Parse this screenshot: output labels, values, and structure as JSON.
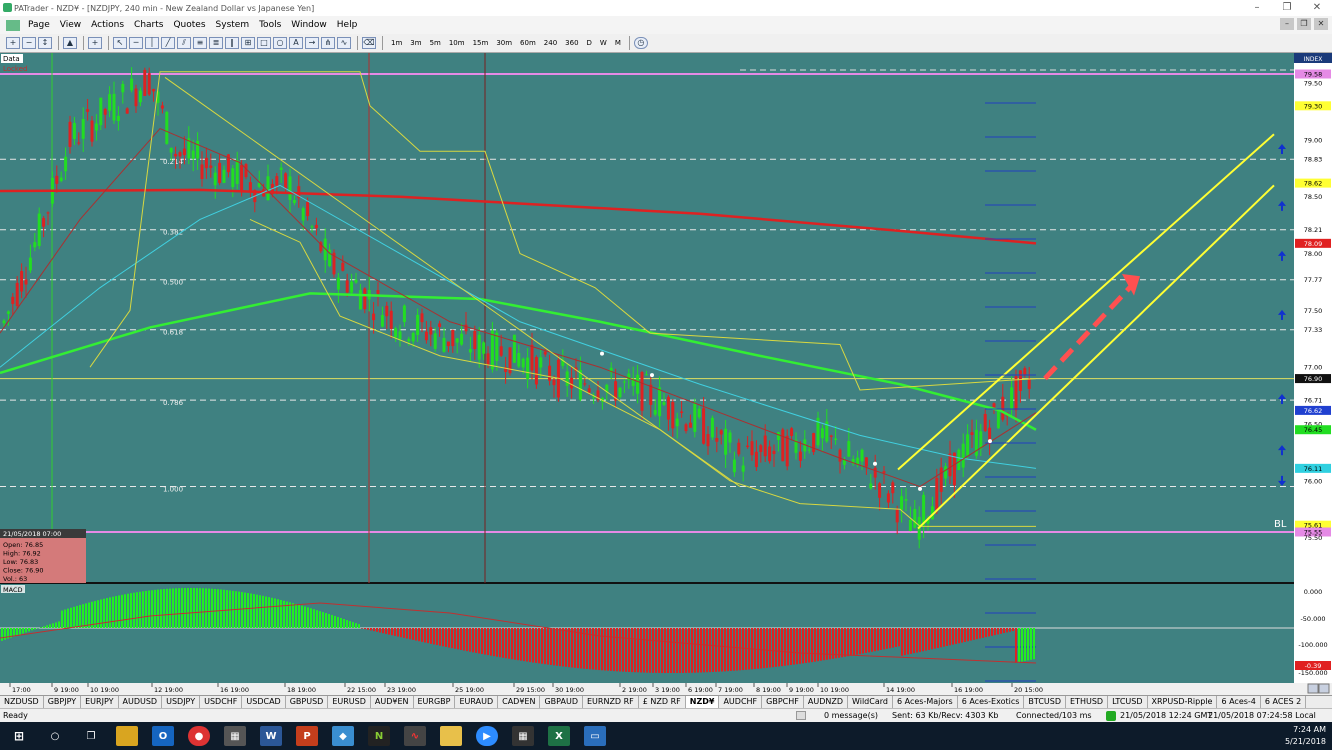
{
  "window": {
    "title": "PATrader - NZD¥ - [NZDJPY, 240 min - New Zealand Dollar vs Japanese Yen]",
    "minimize": "–",
    "maximize": "❐",
    "close": "✕"
  },
  "menu": [
    "Page",
    "View",
    "Actions",
    "Charts",
    "Quotes",
    "System",
    "Tools",
    "Window",
    "Help"
  ],
  "toolbar": {
    "timeframes": [
      "1m",
      "3m",
      "5m",
      "10m",
      "15m",
      "30m",
      "60m",
      "240",
      "360",
      "D",
      "W",
      "M"
    ]
  },
  "chart": {
    "data_label": "Data",
    "locked_label": "Locked",
    "index_label": "INDEX",
    "bl_label": "BL",
    "fib_labels": [
      "0.214",
      "0.382",
      "0.500",
      "0.618",
      "0.786",
      "1.000"
    ],
    "price_axis": [
      {
        "v": "79.58",
        "style": "pink"
      },
      {
        "v": "79.50",
        "style": "plain"
      },
      {
        "v": "79.30",
        "style": "yellow"
      },
      {
        "v": "79.00",
        "style": "plain"
      },
      {
        "v": "78.83",
        "style": "white"
      },
      {
        "v": "78.62",
        "style": "yellow"
      },
      {
        "v": "78.50",
        "style": "plain"
      },
      {
        "v": "78.21",
        "style": "white"
      },
      {
        "v": "78.09",
        "style": "red"
      },
      {
        "v": "78.00",
        "style": "plain"
      },
      {
        "v": "77.77",
        "style": "white"
      },
      {
        "v": "77.50",
        "style": "plain"
      },
      {
        "v": "77.33",
        "style": "white"
      },
      {
        "v": "77.00",
        "style": "plain"
      },
      {
        "v": "76.90",
        "style": "black"
      },
      {
        "v": "76.71",
        "style": "white"
      },
      {
        "v": "76.62",
        "style": "blue"
      },
      {
        "v": "76.50",
        "style": "plain"
      },
      {
        "v": "76.45",
        "style": "green"
      },
      {
        "v": "76.11",
        "style": "cyan"
      },
      {
        "v": "76.00",
        "style": "plain"
      },
      {
        "v": "75.61",
        "style": "yellow"
      },
      {
        "v": "75.55",
        "style": "pink"
      },
      {
        "v": "75.50",
        "style": "plain"
      }
    ],
    "date_axis": [
      "17:00",
      "9 19:00",
      "10 19:00",
      "12 19:00",
      "16 19:00",
      "18 19:00",
      "22 15:00",
      "23 19:00",
      "25 19:00",
      "29 15:00",
      "30 19:00",
      "2 19:00",
      "3 19:00",
      "6 19:00",
      "7 19:00",
      "8 19:00",
      "9 19:00",
      "10 19:00",
      "14 19:00",
      "16 19:00",
      "20 15:00"
    ],
    "info_box": {
      "date": "21/05/2018 07:00",
      "open": "Open: 76.85",
      "high": "High: 76.92",
      "low": "Low: 76.83",
      "close": "Close: 76.90",
      "vol": "Vol.: 63"
    }
  },
  "macd": {
    "label": "MACD",
    "axis": [
      "0.000",
      "-50.000",
      "-100.000",
      "-150.000"
    ],
    "current": "-0.39"
  },
  "tabs": [
    "NZDUSD",
    "GBPJPY",
    "EURJPY",
    "AUDUSD",
    "USDJPY",
    "USDCHF",
    "USDCAD",
    "GBPUSD",
    "EURUSD",
    "AUD¥EN",
    "EURGBP",
    "EURAUD",
    "CAD¥EN",
    "GBPAUD",
    "EURNZD RF",
    "£ NZD RF",
    "NZD¥",
    "AUDCHF",
    "GBPCHF",
    "AUDNZD",
    "WildCard",
    "6 Aces-Majors",
    "6 Aces-Exotics",
    "BTCUSD",
    "ETHUSD",
    "LTCUSD",
    "XRPUSD-Ripple",
    "6 Aces-4",
    "6 ACES 2"
  ],
  "active_tab": "NZD¥",
  "status": {
    "ready": "Ready",
    "messages": "0 message(s)",
    "traffic": "Sent: 63 Kb/Recv: 4303 Kb",
    "connected": "Connected/103 ms",
    "gmt": "21/05/2018 12:24 GMT",
    "local": "21/05/2018 07:24:58 Local"
  },
  "taskbar": {
    "time": "7:24 AM",
    "date": "5/21/2018"
  }
}
